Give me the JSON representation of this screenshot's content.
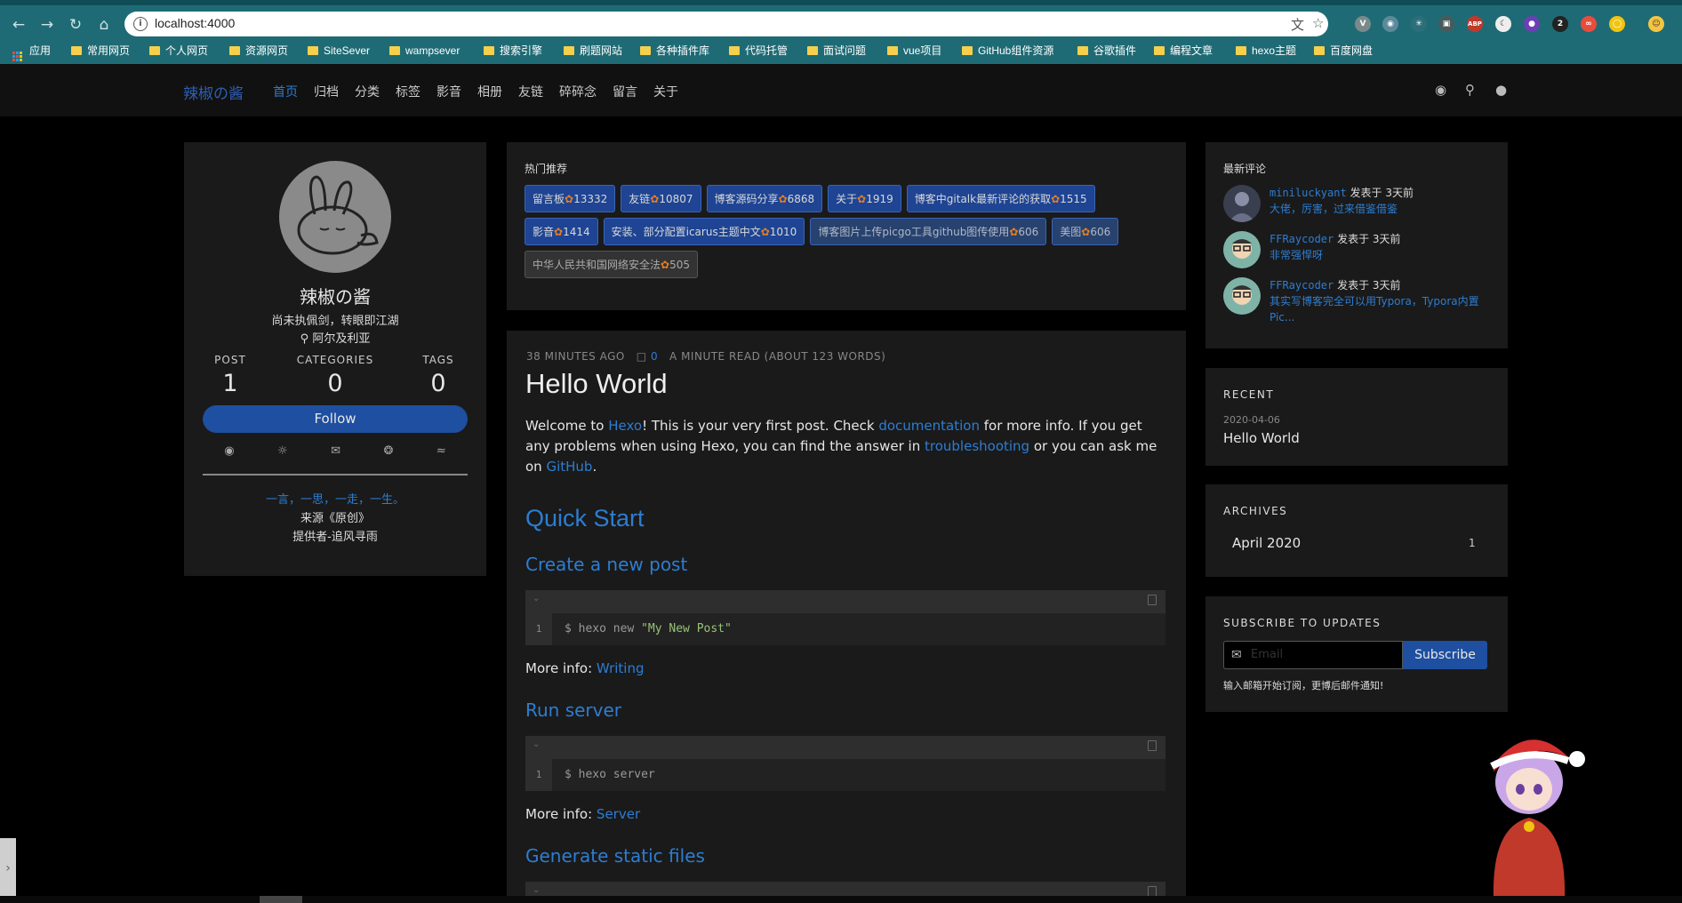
{
  "browser": {
    "url": "localhost:4000",
    "bookmarks": [
      "应用",
      "常用网页",
      "个人网页",
      "资源网页",
      "SiteSever",
      "wampsever",
      "搜索引擎",
      "刷题网站",
      "各种插件库",
      "代码托管",
      "面试问题",
      "vue项目",
      "GitHub组件资源",
      "谷歌插件",
      "编程文章",
      "hexo主题",
      "百度网盘"
    ],
    "ext_badge": "2"
  },
  "site": {
    "logo": "辣椒の酱",
    "menu": [
      "首页",
      "归档",
      "分类",
      "标签",
      "影音",
      "相册",
      "友链",
      "碎碎念",
      "留言",
      "关于"
    ]
  },
  "profile": {
    "name": "辣椒の酱",
    "bio": "尚未执佩剑，转眼即江湖",
    "location": "阿尔及利亚",
    "stats": [
      {
        "label": "POST",
        "value": "1"
      },
      {
        "label": "CATEGORIES",
        "value": "0"
      },
      {
        "label": "TAGS",
        "value": "0"
      }
    ],
    "follow_label": "Follow",
    "quote": {
      "text": "一言，一思，一走，一生。",
      "source": "来源《原创》",
      "provider": "提供者-追风寻雨"
    }
  },
  "hot": {
    "title": "热门推荐",
    "tags": [
      {
        "name": "留言板",
        "count": "13332"
      },
      {
        "name": "友链",
        "count": "10807"
      },
      {
        "name": "博客源码分享",
        "count": "6868"
      },
      {
        "name": "关于",
        "count": "1919"
      },
      {
        "name": "博客中gitalk最新评论的获取",
        "count": "1515"
      },
      {
        "name": "影音",
        "count": "1414"
      },
      {
        "name": "安装、部分配置icarus主题中文",
        "count": "1010"
      },
      {
        "name": "博客图片上传picgo工具github图传使用",
        "count": "606"
      },
      {
        "name": "美图",
        "count": "606"
      },
      {
        "name": "中华人民共和国网络安全法",
        "count": "505"
      }
    ]
  },
  "post": {
    "time_ago": "38 MINUTES AGO",
    "comments": "0",
    "read": "A MINUTE READ (ABOUT 123 WORDS)",
    "title": "Hello World",
    "intro": {
      "p1": "Welcome to ",
      "hexo": "Hexo",
      "p2": "! This is your very first post. Check ",
      "docs": "documentation",
      "p3": " for more info. If you get any problems when using Hexo, you can find the answer in ",
      "trouble": "troubleshooting",
      "p4": " or you can ask me on ",
      "github": "GitHub",
      "p5": "."
    },
    "quick_start": "Quick Start",
    "sections": [
      {
        "heading": "Create a new post",
        "code_cmd": "$ hexo new ",
        "code_str": "\"My New Post\"",
        "more_label": "More info: ",
        "more_link": "Writing"
      },
      {
        "heading": "Run server",
        "code_cmd": "$ hexo server",
        "code_str": "",
        "more_label": "More info: ",
        "more_link": "Server"
      },
      {
        "heading": "Generate static files"
      }
    ],
    "line_no": "1"
  },
  "sidebar": {
    "comments_title": "最新评论",
    "comments": [
      {
        "user": "miniluckyant",
        "action": " 发表于 3天前",
        "text": "大佬，厉害，过来借鉴借鉴"
      },
      {
        "user": "FFRaycoder",
        "action": " 发表于 3天前",
        "text": "非常强悍呀"
      },
      {
        "user": "FFRaycoder",
        "action": " 发表于 3天前",
        "text": "其实写博客完全可以用Typora，Typora内置Pic..."
      }
    ],
    "recent_title": "RECENT",
    "recent_date": "2020-04-06",
    "recent_post": "Hello World",
    "archives_title": "ARCHIVES",
    "archive_month": "April 2020",
    "archive_count": "1",
    "subscribe_title": "SUBSCRIBE TO UPDATES",
    "email_placeholder": "Email",
    "subscribe_btn": "Subscribe",
    "subscribe_hint": "输入邮箱开始订阅，更博后邮件通知!"
  }
}
